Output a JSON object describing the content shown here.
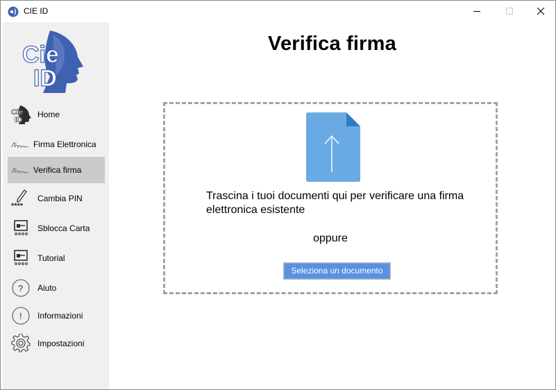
{
  "window": {
    "title": "CIE ID",
    "controls": [
      "minimize-icon",
      "maximize-icon",
      "close-icon"
    ]
  },
  "sidebar": {
    "logo": {
      "text_top": "Cie",
      "text_bottom": "ID",
      "color": "#3f61b2"
    },
    "items": [
      {
        "label": "Home",
        "icon": "cie-id-icon",
        "active": false
      },
      {
        "label": "Firma Elettronica",
        "icon": "signature-icon",
        "active": false
      },
      {
        "label": "Verifica firma",
        "icon": "signature-icon",
        "active": true
      },
      {
        "label": "Cambia PIN",
        "icon": "pen-pin-icon",
        "active": false
      },
      {
        "label": "Sblocca Carta",
        "icon": "card-unlock-icon",
        "active": false
      },
      {
        "label": "Tutorial",
        "icon": "tutorial-icon",
        "active": false
      },
      {
        "label": "Aiuto",
        "icon": "question-icon",
        "active": false
      },
      {
        "label": "Informazioni",
        "icon": "info-icon",
        "active": false
      },
      {
        "label": "Impostazioni",
        "icon": "gear-icon",
        "active": false
      }
    ]
  },
  "main": {
    "title": "Verifica firma",
    "drop_text": "Trascina i tuoi documenti qui per verificare una firma elettronica esistente",
    "or_text": "oppure",
    "select_button": "Seleziona un documento"
  },
  "colors": {
    "accent": "#5a91e0",
    "doc_icon": "#6aaae4",
    "active_item": "#cbcbcb",
    "sidebar_bg": "#f0f0f0"
  }
}
